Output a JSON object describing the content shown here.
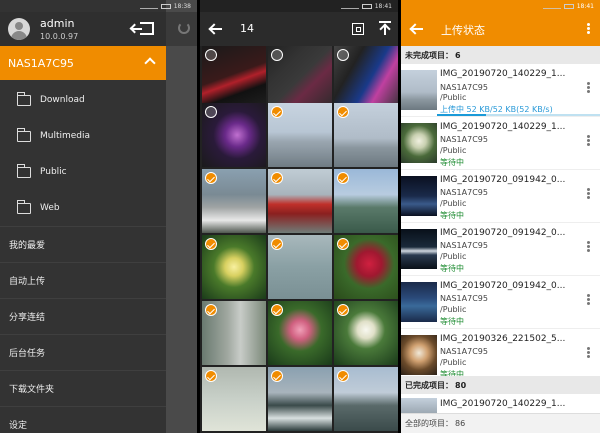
{
  "status": {
    "time_1": "18:38",
    "time_2": "18:41",
    "time_3": "18:41"
  },
  "drawer": {
    "user_name": "admin",
    "user_ip": "10.0.0.97",
    "nas_name": "NAS1A7C95",
    "folders": [
      {
        "label": "Download"
      },
      {
        "label": "Multimedia"
      },
      {
        "label": "Public"
      },
      {
        "label": "Web"
      }
    ],
    "menu": [
      {
        "label": "我的最爱"
      },
      {
        "label": "自动上传"
      },
      {
        "label": "分享连结"
      },
      {
        "label": "后台任务"
      },
      {
        "label": "下载文件夹"
      },
      {
        "label": "设定"
      }
    ]
  },
  "picker": {
    "selected_count": "14"
  },
  "upload": {
    "title": "上传状态",
    "incomplete_label": "未完成项目：",
    "incomplete_count": "6",
    "completed_label": "已完成项目：",
    "completed_count": "80",
    "footer_label": "全部的项目：",
    "footer_count": "86",
    "items": [
      {
        "name": "IMG_20190720_140229_1...",
        "path": "NAS1A7C95",
        "path2": "/Public",
        "status": "上传中",
        "progress_text": "52 KB/52 KB(52 KB/s)",
        "progress": 0.3
      },
      {
        "name": "IMG_20190720_140229_1...",
        "path": "NAS1A7C95",
        "path2": "/Public",
        "status": "等待中"
      },
      {
        "name": "IMG_20190720_091942_0...",
        "path": "NAS1A7C95",
        "path2": "/Public",
        "status": "等待中"
      },
      {
        "name": "IMG_20190720_091942_0...",
        "path": "NAS1A7C95",
        "path2": "/Public",
        "status": "等待中"
      },
      {
        "name": "IMG_20190720_091942_0...",
        "path": "NAS1A7C95",
        "path2": "/Public",
        "status": "等待中"
      },
      {
        "name": "IMG_20190326_221502_5...",
        "path": "NAS1A7C95",
        "path2": "/Public",
        "status": "等待中"
      }
    ],
    "completed_item_name": "IMG_20190720_140229_1..."
  },
  "colors": {
    "accent": "#f08c00",
    "waiting": "#1a8a2e",
    "uploading": "#2a9ad8"
  }
}
